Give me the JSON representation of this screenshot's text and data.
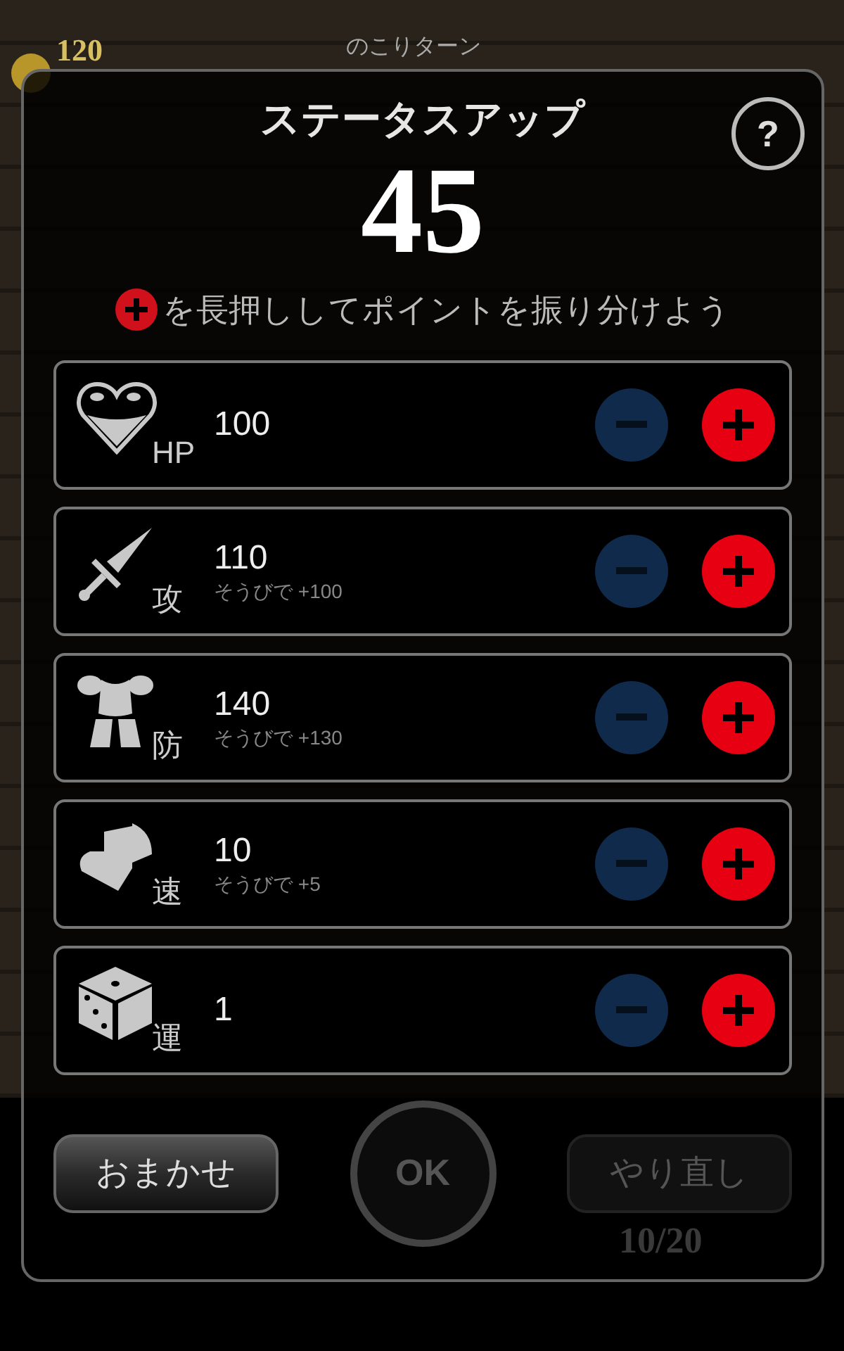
{
  "game": {
    "coins": "120",
    "turns_label": "のこりターン",
    "progress": "10/20"
  },
  "dialog": {
    "title": "ステータスアップ",
    "points": "45",
    "help": "?",
    "hint": "を長押ししてポイントを振り分けよう",
    "stats": [
      {
        "kind": "heart",
        "label": "HP",
        "value": "100",
        "minus_disabled": true,
        "plus_disabled": false
      },
      {
        "kind": "sword",
        "label": "攻",
        "value": "110",
        "bonus": "そうびで +100",
        "minus_disabled": true,
        "plus_disabled": false
      },
      {
        "kind": "armor",
        "label": "防",
        "value": "140",
        "bonus": "そうびで +130",
        "minus_disabled": true,
        "plus_disabled": false
      },
      {
        "kind": "boot",
        "label": "速",
        "value": "10",
        "bonus": "そうびで +5",
        "minus_disabled": true,
        "plus_disabled": false
      },
      {
        "kind": "dice",
        "label": "運",
        "value": "1",
        "minus_disabled": true,
        "plus_disabled": false
      }
    ],
    "buttons": [
      {
        "kind": "auto",
        "label": "おまかせ",
        "disabled": false
      },
      {
        "kind": "ok",
        "label": "OK",
        "disabled": true
      },
      {
        "kind": "reset",
        "label": "やり直し",
        "disabled": true
      }
    ]
  }
}
